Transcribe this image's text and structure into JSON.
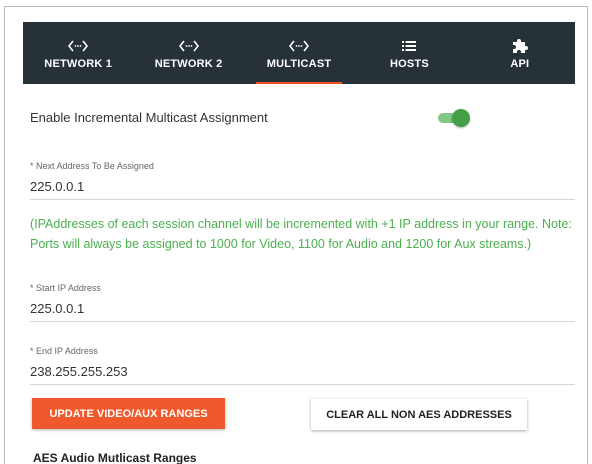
{
  "tabs": [
    {
      "label": "NETWORK 1",
      "icon": "code-brackets-icon"
    },
    {
      "label": "NETWORK 2",
      "icon": "code-brackets-icon"
    },
    {
      "label": "MULTICAST",
      "icon": "code-brackets-icon",
      "active": true
    },
    {
      "label": "HOSTS",
      "icon": "list-icon"
    },
    {
      "label": "API",
      "icon": "puzzle-icon"
    }
  ],
  "incremental": {
    "label": "Enable Incremental Multicast Assignment",
    "enabled": true
  },
  "next_address": {
    "label": "* Next Address To Be Assigned",
    "value": "225.0.0.1"
  },
  "note": "(IPAddresses of each session channel will be incremented with +1 IP address in your range. Note: Ports will always be assigned to 1000 for Video, 1100 for Audio and 1200 for Aux streams.)",
  "start_ip": {
    "label": "* Start IP Address",
    "value": "225.0.0.1"
  },
  "end_ip": {
    "label": "* End IP Address",
    "value": "238.255.255.253"
  },
  "buttons": {
    "update": "UPDATE VIDEO/AUX RANGES",
    "clear": "CLEAR ALL NON AES ADDRESSES"
  },
  "aes_section_title": "AES Audio Mutlicast Ranges",
  "colors": {
    "tabbar_bg": "#263238",
    "accent": "#f0592b",
    "note_green": "#4caf50",
    "toggle_green": "#43a047"
  }
}
